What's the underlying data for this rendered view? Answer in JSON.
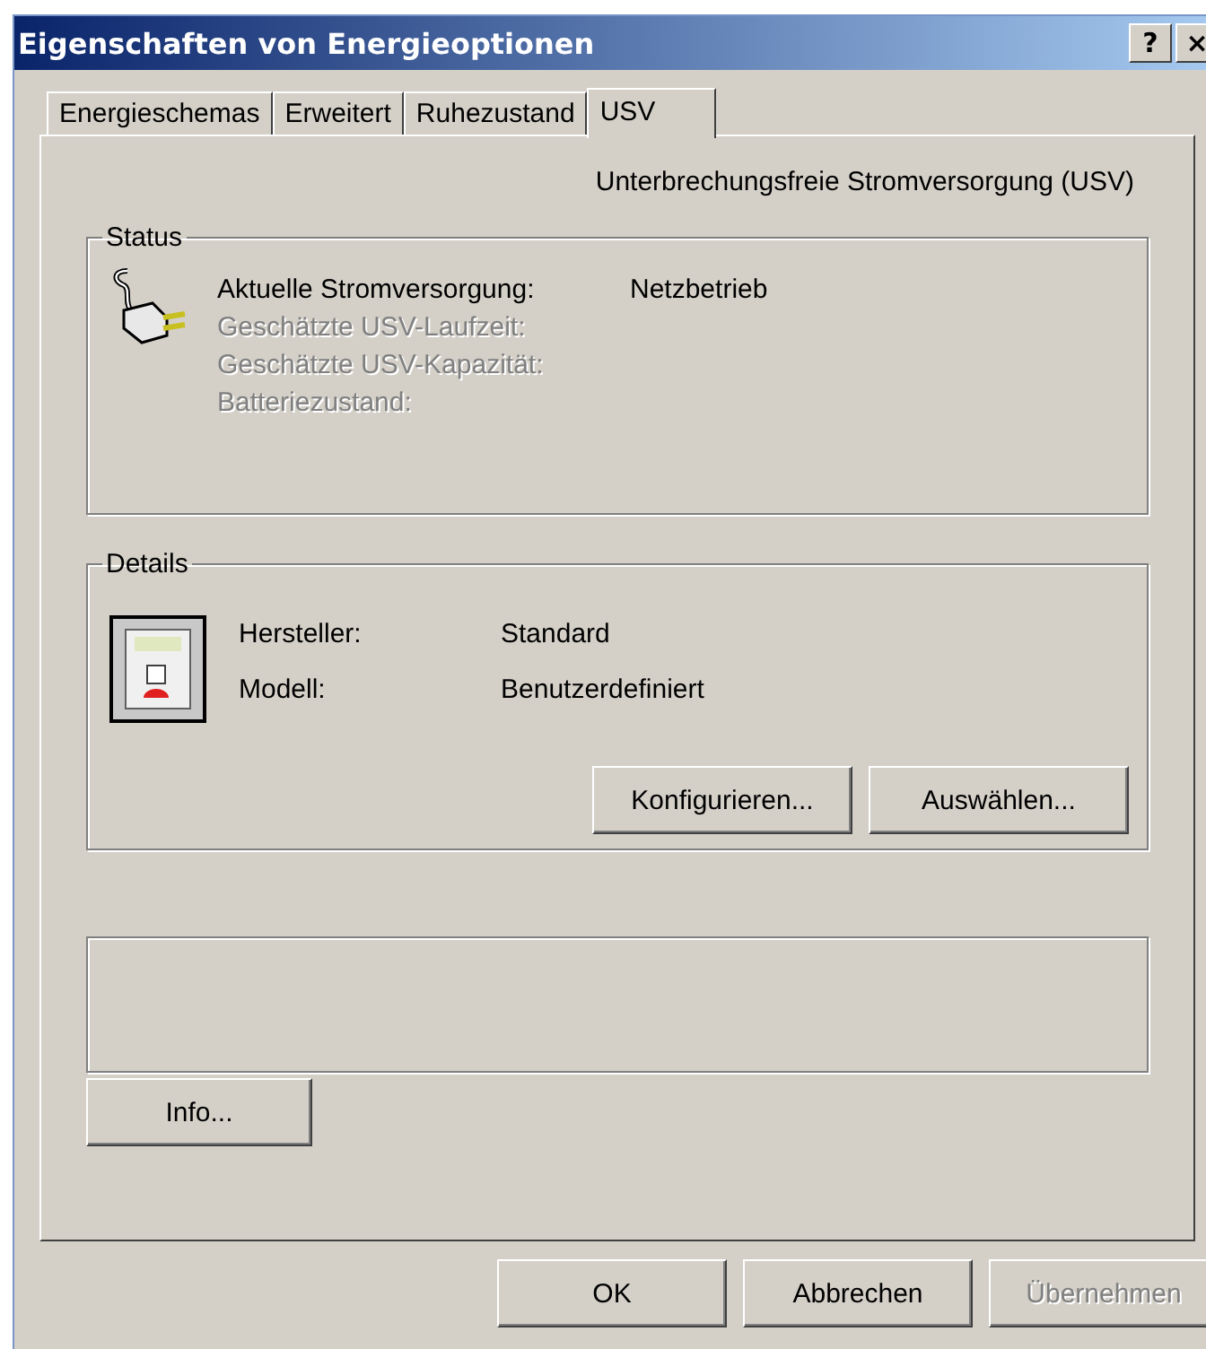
{
  "window": {
    "title": "Eigenschaften von Energieoptionen",
    "title_buttons": [
      "?",
      "×"
    ]
  },
  "tabs": [
    {
      "label": "Energieschemas",
      "selected": false
    },
    {
      "label": "Erweitert",
      "selected": false
    },
    {
      "label": "Ruhezustand",
      "selected": false
    },
    {
      "label": "USV",
      "selected": true
    }
  ],
  "heading": "Unterbrechungsfreie Stromversorgung (USV)",
  "status": {
    "title": "Status",
    "rows": [
      {
        "label": "Aktuelle Stromversorgung:",
        "value": "Netzbetrieb",
        "disabled": false
      },
      {
        "label": "Geschätzte USV-Laufzeit:",
        "disabled": true
      },
      {
        "label": "Geschätzte USV-Kapazität:",
        "disabled": true
      },
      {
        "label": "Batteriezustand:",
        "disabled": true
      }
    ]
  },
  "details": {
    "title": "Details",
    "rows": [
      {
        "label": "Hersteller:",
        "value": "Standard"
      },
      {
        "label": "Modell:",
        "value": "Benutzerdefiniert"
      }
    ],
    "buttons": [
      "Konfigurieren...",
      "Auswählen..."
    ]
  },
  "info_button": "Info...",
  "dialog_buttons": [
    {
      "label": "OK",
      "disabled": false
    },
    {
      "label": "Abbrechen",
      "disabled": false
    },
    {
      "label": "Übernehmen",
      "disabled": true
    }
  ]
}
